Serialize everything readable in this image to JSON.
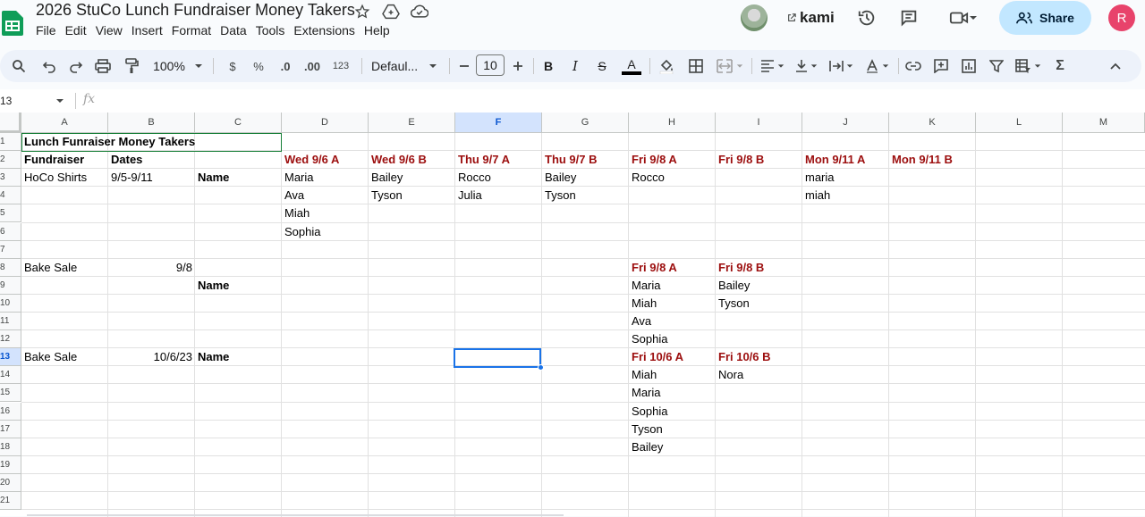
{
  "document": {
    "title": "2026 StuCo Lunch Fundraiser Money Takers"
  },
  "menu": [
    "File",
    "Edit",
    "View",
    "Insert",
    "Format",
    "Data",
    "Tools",
    "Extensions",
    "Help"
  ],
  "header_right": {
    "kami_label": "kami",
    "share_label": "Share",
    "user_initial": "R"
  },
  "toolbar": {
    "zoom": "100%",
    "currency": "$",
    "percent": "%",
    "decrease_decimal": ".0",
    "increase_decimal": ".00",
    "number_format": "123",
    "font": "Defaul...",
    "font_size": "10",
    "bold": "B",
    "italic": "I",
    "strike": "S",
    "text_color": "A",
    "sum": "Σ"
  },
  "formula_bar": {
    "name_box": "13",
    "fx": "fx"
  },
  "columns": [
    "A",
    "B",
    "C",
    "D",
    "E",
    "F",
    "G",
    "H",
    "I",
    "J",
    "K",
    "L",
    "M"
  ],
  "selected_column": "F",
  "rows": [
    "1",
    "2",
    "3",
    "4",
    "5",
    "6",
    "7",
    "8",
    "9",
    "10",
    "11",
    "12",
    "13",
    "14",
    "15",
    "16",
    "17",
    "18",
    "19",
    "20",
    "21"
  ],
  "selected_row": "13",
  "cells": {
    "A1": "Lunch Funraiser Money Takers",
    "A2": "Fundraiser",
    "B2": "Dates",
    "D2": "Wed 9/6 A",
    "E2": "Wed 9/6 B",
    "F2": "Thu 9/7 A",
    "G2": "Thu 9/7 B",
    "H2": "Fri 9/8 A",
    "I2": "Fri 9/8 B",
    "J2": "Mon 9/11 A",
    "K2": "Mon 9/11 B",
    "A3": "HoCo Shirts",
    "B3": "9/5-9/11",
    "C3": "Name",
    "D3": "Maria",
    "E3": "Bailey",
    "F3": "Rocco",
    "G3": "Bailey",
    "H3": "Rocco",
    "J3": "maria",
    "D4": "Ava",
    "E4": "Tyson",
    "F4": "Julia",
    "G4": "Tyson",
    "J4": "miah",
    "D5": "Miah",
    "D6": "Sophia",
    "A8": "Bake Sale",
    "B8": "9/8",
    "H8": "Fri 9/8 A",
    "I8": "Fri 9/8 B",
    "C9": "Name",
    "H9": "Maria",
    "I9": "Bailey",
    "H10": "Miah",
    "I10": "Tyson",
    "H11": "Ava",
    "H12": "Sophia",
    "A13": "Bake Sale",
    "B13": "10/6/23",
    "C13": "Name",
    "H13": "Fri 10/6 A",
    "I13": "Fri 10/6 B",
    "H14": "Miah",
    "I14": "Nora",
    "H15": "Maria",
    "H16": "Sophia",
    "H17": "Tyson",
    "H18": "Bailey"
  },
  "colors": {
    "header_red": "#9c0e0e",
    "selection_blue": "#1a73e8",
    "share_bg": "#c2e7ff",
    "avatar_bg": "#e8436b",
    "sheets_green": "#0f9d58"
  }
}
